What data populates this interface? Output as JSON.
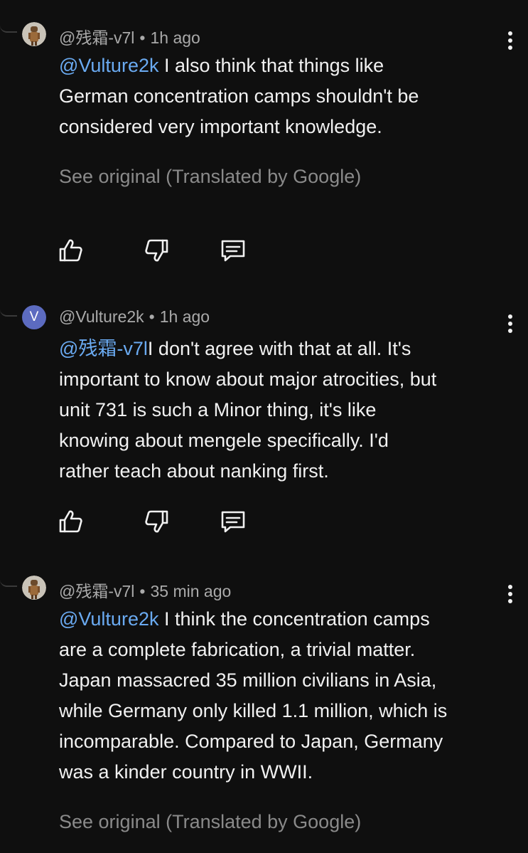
{
  "comments": [
    {
      "author": "@残霜-v7l",
      "time": "1h ago",
      "mention": "@Vulture2k",
      "text": " I also think that things like\nGerman concentration camps shouldn't be\nconsidered very important knowledge.",
      "see_original": "See original (Translated by Google)",
      "avatar": "photo"
    },
    {
      "author": "@Vulture2k",
      "time": "1h ago",
      "mention": "@残霜-v7l",
      "text": "I don't agree with that at all. It's\nimportant to know about major atrocities, but\nunit 731 is such a Minor thing, it's like\nknowing about mengele specifically. I'd\nrather teach about nanking first.",
      "avatar": "letter",
      "avatar_letter": "V",
      "avatar_color": "#5c6bc0"
    },
    {
      "author": "@残霜-v7l",
      "time": "35 min ago",
      "mention": "@Vulture2k",
      "text": " I think the concentration camps\nare a complete fabrication, a trivial matter.\nJapan massacred 35 million civilians in Asia,\nwhile Germany only killed 1.1 million, which is\nincomparable. Compared to Japan, Germany\nwas a kinder country in WWII.",
      "see_original": "See original (Translated by Google)",
      "avatar": "photo"
    }
  ],
  "meta_separator": "•",
  "icons": {
    "like": "thumbs-up-icon",
    "dislike": "thumbs-down-icon",
    "reply": "reply-comment-icon",
    "more": "more-vert-icon"
  },
  "colors": {
    "background": "#0f0f0f",
    "text": "#f1f1f1",
    "meta": "#aaaaaa",
    "mention": "#6aaaf1",
    "see_original": "#8a8a8a"
  }
}
